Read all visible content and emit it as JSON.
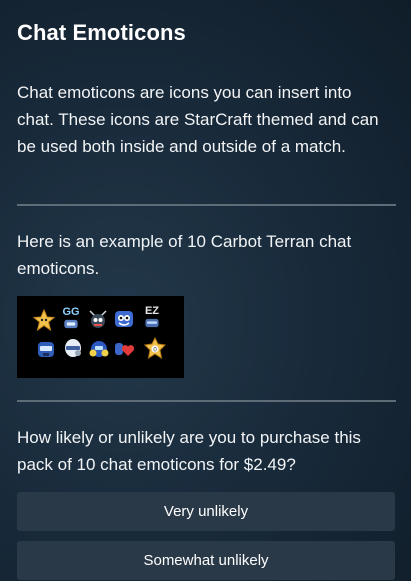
{
  "page": {
    "title": "Chat Emoticons",
    "description": "Chat emoticons are icons you can insert into chat. These icons are StarCraft themed and can be used both inside and outside of a match.",
    "example_text": "Here is an example of 10 Carbot Terran chat emoticons.",
    "question": "How likely or unlikely are you to purchase this pack of 10 chat emoticons for $2.49?"
  },
  "emoticons": {
    "gg_text": "GG",
    "ez_text": "EZ"
  },
  "options": [
    {
      "label": "Very unlikely"
    },
    {
      "label": "Somewhat unlikely"
    }
  ],
  "colors": {
    "background": "#172838",
    "divider": "#5e6c78",
    "option_background": "#2a3947",
    "emote_panel": "#000000"
  }
}
